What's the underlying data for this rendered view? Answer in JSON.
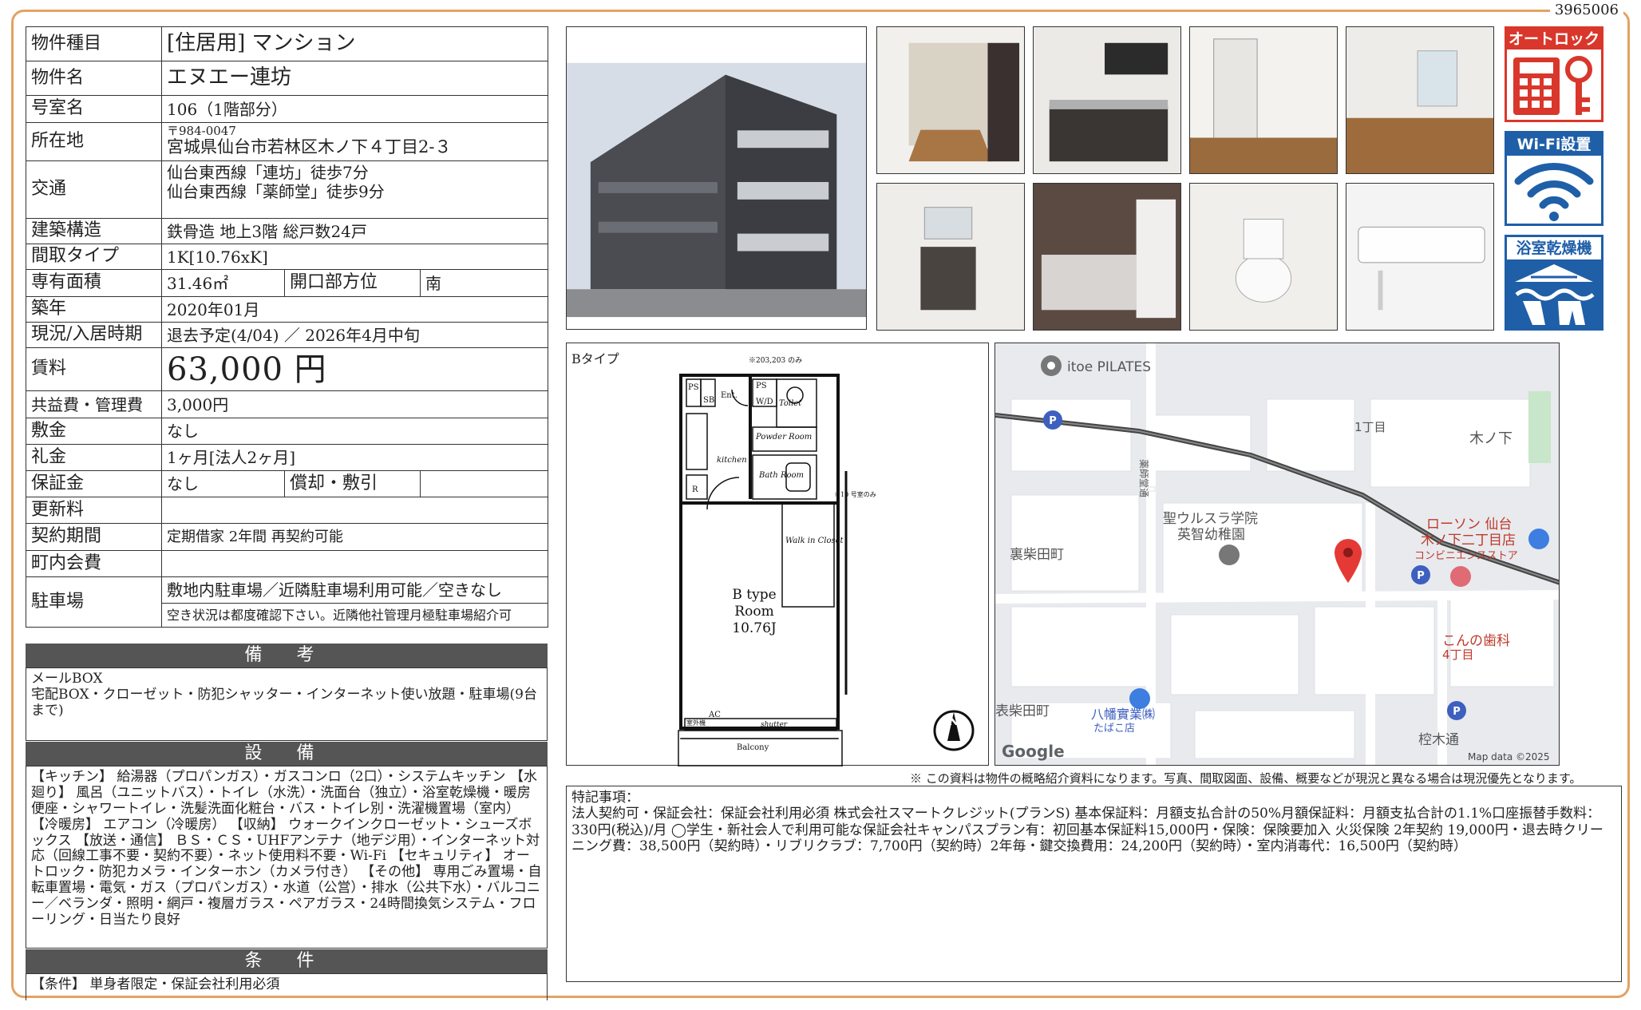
{
  "doc_id": "3965006",
  "info": {
    "type_label": "物件種目",
    "type_value": "[住居用] マンション",
    "name_label": "物件名",
    "name_value": "エヌエー連坊",
    "room_label": "号室名",
    "room_value": "106（1階部分）",
    "addr_label": "所在地",
    "addr_zip": "〒984-0047",
    "addr_value": "宮城県仙台市若林区木ノ下４丁目2-３",
    "traffic_label": "交通",
    "traffic_1": "仙台東西線「連坊」徒歩7分",
    "traffic_2": "仙台東西線「薬師堂」徒歩9分",
    "structure_label": "建築構造",
    "structure_value": "鉄骨造 地上3階 総戸数24戸",
    "layout_label": "間取タイプ",
    "layout_value": "1K[10.76xK]",
    "area_label": "専有面積",
    "area_value": "31.46㎡",
    "direction_label": "開口部方位",
    "direction_value": "南",
    "built_label": "築年",
    "built_value": "2020年01月",
    "status_label": "現況/入居時期",
    "status_value": "退去予定(4/04) ／ 2026年4月中旬",
    "rent_label": "賃料",
    "rent_value": "63,000 円",
    "fee_label": "共益費・管理費",
    "fee_value": "3,000円",
    "deposit_label": "敷金",
    "deposit_value": "なし",
    "key_money_label": "礼金",
    "key_money_value": "1ヶ月[法人2ヶ月]",
    "guarantee_label": "保証金",
    "guarantee_value": "なし",
    "amort_label": "償却・敷引",
    "amort_value": "",
    "renewal_label": "更新料",
    "renewal_value": "",
    "contract_label": "契約期間",
    "contract_value": "定期借家 2年間 再契約可能",
    "community_label": "町内会費",
    "community_value": "",
    "parking_label": "駐車場",
    "parking_value": "敷地内駐車場／近隣駐車場利用可能／空きなし",
    "parking_note": "空き状況は都度確認下さい。近隣他社管理月極駐車場紹介可"
  },
  "remarks": {
    "title": "備 考",
    "text": "メールBOX\n宅配BOX・クローゼット・防犯シャッター・インターネット使い放題・駐車場(9台まで)"
  },
  "equipment": {
    "title": "設 備",
    "text": "【キッチン】 給湯器（プロパンガス）・ガスコンロ（2口）・システムキッチン 【水廻り】 風呂（ユニットバス）・トイレ（水洗）・洗面台（独立）・浴室乾燥機・暖房便座・シャワートイレ・洗髪洗面化粧台・バス・トイレ別・洗濯機置場（室内） 【冷暖房】 エアコン（冷暖房） 【収納】 ウォークインクローゼット・シューズボックス 【放送・通信】 ＢＳ・ＣＳ・UHFアンテナ（地デジ用）・インターネット対応（回線工事不要・契約不要）・ネット使用料不要・Wi-Fi 【セキュリティ】 オートロック・防犯カメラ・インターホン（カメラ付き） 【その他】 専用ごみ置場・自転車置場・電気・ガス（プロパンガス）・水道（公営）・排水（公共下水）・バルコニー／ベランダ・照明・網戸・複層ガラス・ペアガラス・24時間換気システム・フローリング・日当たり良好"
  },
  "conditions": {
    "title": "条 件",
    "text": "【条件】 単身者限定・保証会社利用必須"
  },
  "badges": {
    "autolock": "オートロック",
    "wifi": "Wi-Fi設置",
    "bath_dryer": "浴室乾燥機"
  },
  "floorplan": {
    "type_label": "Bタイプ",
    "note_top": "※203,203 のみ",
    "note_side": "※10 号室のみ",
    "room_label_1": "B type",
    "room_label_2": "Room",
    "room_label_3": "10.76J",
    "labels": {
      "ps1": "PS",
      "sb": "SB",
      "ent": "Ent.",
      "ps2": "PS",
      "wd": "W/D",
      "toilet": "Toilet",
      "powder": "Powder Room",
      "kitchen": "kitchen",
      "bath": "Bath Room",
      "r": "R",
      "walkin": "Walk in Closet",
      "ac": "AC",
      "outdoor": "室外機",
      "shutter": "shutter",
      "balcony": "Balcony"
    }
  },
  "map": {
    "labels": {
      "pilates": "itoe PILATES",
      "chome1": "1丁目",
      "kinoshita": "木ノ下",
      "yakushido": "薬師堂通",
      "school_1": "聖ウルスラ学院",
      "school_2": "英智幼稚園",
      "urashibata": "裏柴田町",
      "lawson_1": "ローソン 仙台",
      "lawson_2": "木ノ下二丁目店",
      "lawson_3": "コンビニエンスストア",
      "dental": "こんの歯科",
      "chome4": "4丁目",
      "omoteshibata": "表柴田町",
      "yawata_1": "八幡實業㈱",
      "yawata_2": "たばこ店",
      "google": "Google",
      "kurunoki": "椌木通",
      "mapdata": "Map data ©2025"
    }
  },
  "disclaimer": "※ この資料は物件の概略紹介資料になります。写真、間取図面、設備、概要などが現況と異なる場合は現況優先となります。",
  "tokki": {
    "text": "特記事項：\n法人契約可・保証会社：保証会社利用必須 株式会社スマートクレジット(プランS) 基本保証料：月額支払合計の50%月額保証料：月額支払合計の1.1%口座振替手数料：330円(税込)/月 ◯学生・新社会人で利用可能な保証会社キャンパスプラン有：初回基本保証料15,000円・保険：保険要加入 火災保険 2年契約 19,000円・退去時クリーニング費：38,500円（契約時）・リブリクラブ：7,700円（契約時）2年毎・鍵交換費用：24,200円（契約時）・室内消毒代：16,500円（契約時）"
  }
}
